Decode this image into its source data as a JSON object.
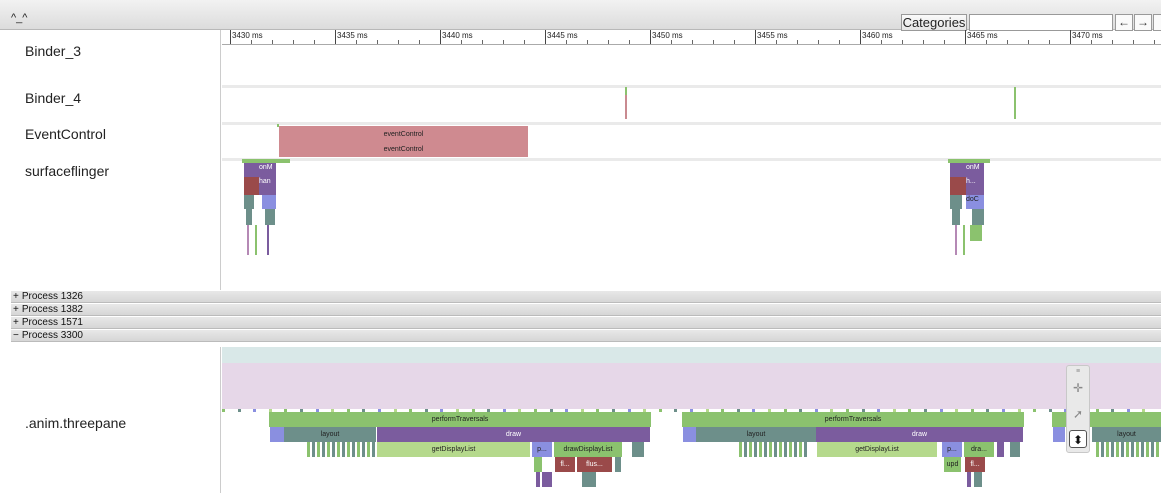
{
  "toolbar": {
    "collapse_label": "^_^",
    "categories_label": "Categories",
    "search_value": "",
    "prev_label": "←",
    "next_label": "→"
  },
  "ruler": {
    "ticks": [
      "3430 ms",
      "3435 ms",
      "3440 ms",
      "3445 ms",
      "3450 ms",
      "3455 ms",
      "3460 ms",
      "3465 ms",
      "3470 ms"
    ]
  },
  "tracks": {
    "binder3": "Binder_3",
    "binder4": "Binder_4",
    "eventcontrol": "EventControl",
    "surfaceflinger": "surfaceflinger",
    "threepane": ".anim.threepane"
  },
  "slices": {
    "event_control_1": "eventControl",
    "event_control_2": "eventControl",
    "sf_onm_1": "onM",
    "sf_han": "han",
    "sf_onm_2": "onM",
    "sf_h": "h...",
    "sf_doc": "doC",
    "perform_1": "performTraversals",
    "perform_2": "performTraversals",
    "layout_1": "layout",
    "layout_2": "layout",
    "layout_3": "layout",
    "draw_1": "draw",
    "draw_2": "draw",
    "getdisplaylist_1": "getDisplayList",
    "getdisplaylist_2": "getDisplayList",
    "p_1": "p...",
    "p_2": "p...",
    "drawdisplaylist": "drawDisplayList",
    "dra": "dra...",
    "fl_1": "fl...",
    "flus": "flus...",
    "upd": "upd",
    "fl_2": "fl..."
  },
  "processes": [
    {
      "sign": "+",
      "label": "Process 1326"
    },
    {
      "sign": "+",
      "label": "Process 1382"
    },
    {
      "sign": "+",
      "label": "Process 1571"
    },
    {
      "sign": "−",
      "label": "Process 3300"
    }
  ],
  "colors": {
    "event_pink": "#cf8a90",
    "green": "#8bc26e",
    "purple": "#7b5c9e",
    "teal": "#6d8f8a",
    "light_green": "#b5d98c",
    "blue": "#8a8fe0",
    "maroon": "#9a4a4a"
  }
}
